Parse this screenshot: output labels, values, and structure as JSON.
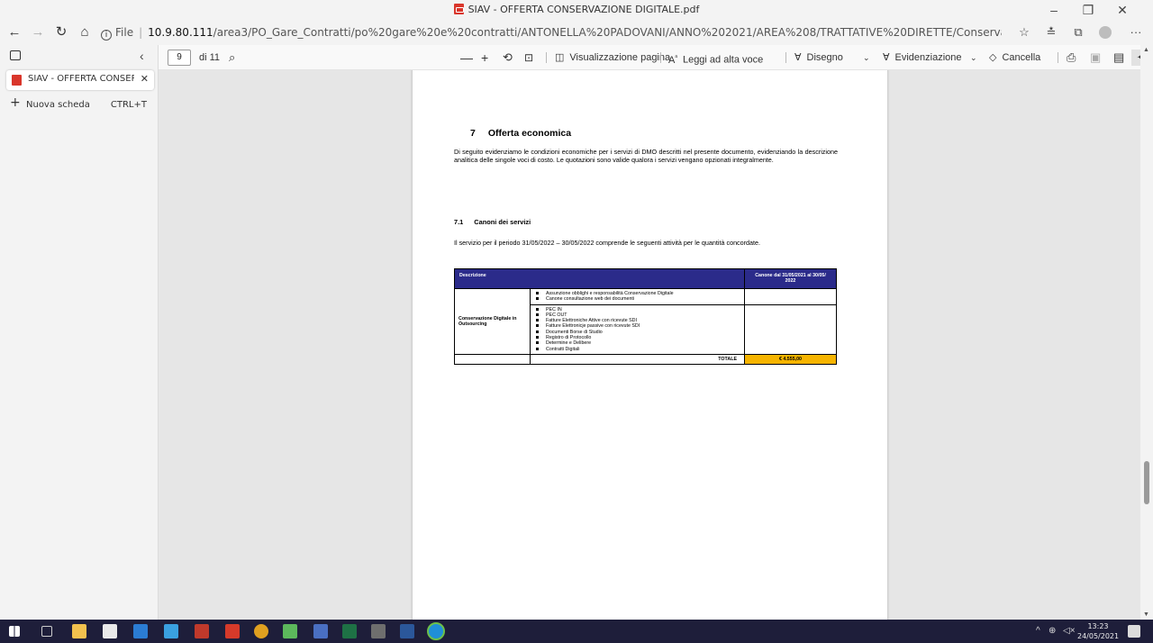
{
  "window": {
    "title": "SIAV - OFFERTA CONSERVAZIONE DIGITALE.pdf",
    "minimize": "–",
    "maximize": "❐",
    "close": "✕"
  },
  "addressbar": {
    "protocol": "File",
    "host": "10.9.80.111",
    "path": "/area3/PO_Gare_Contratti/po%20gare%20e%20contratti/ANTONELLA%20PADOVANI/ANNO%202021/AREA%208/TRATTATIVE%20DIRETTE/Conservazione%20Digitale%20AgID/Preventivo..."
  },
  "tabs": {
    "active_title": "SIAV - OFFERTA CONSERVAZION",
    "new_tab_label": "Nuova scheda",
    "new_tab_shortcut": "CTRL+T"
  },
  "pdf_toolbar": {
    "page_current": "9",
    "page_total": "di 11",
    "page_view": "Visualizzazione pagina",
    "read_aloud": "Leggi ad alta voce",
    "draw": "Disegno",
    "highlight": "Evidenziazione",
    "erase": "Cancella"
  },
  "document": {
    "section_num": "7",
    "section_title": "Offerta economica",
    "intro": "Di seguito evidenziamo le condizioni economiche per i servizi di DMO descritti nel presente documento, evidenziando la descrizione analitica delle singole voci di costo. Le quotazioni sono valide qualora i servizi vengano opzionati integralmente.",
    "subsection_num": "7.1",
    "subsection_title": "Canoni dei servizi",
    "period_text": "Il servizio  per il periodo 31/05/2022 – 30/05/2022  comprende le seguenti attività per le quantità concordate.",
    "table": {
      "header_desc": "Descrizione",
      "header_fee": "Canone dal 31/05/2021 al 30/05/ 2022",
      "category": "Conservazione Digitale in Outsourcing",
      "group1": [
        "Assunzione obblighi e responsabilità Conservazione Digitale",
        "Canone consultazione web dei documenti"
      ],
      "group2": [
        "PEC IN",
        "PEC OUT",
        "Fatture Elettroniche Attive con ricevute SDI",
        "Fatture Elettronicje  passive con ricevute SDI",
        "Documenti Borse di Studio",
        "Registro di Protocollo",
        "Determine e Delibere",
        "Contratti Digitali"
      ],
      "total_label": "TOTALE",
      "total_value": "€ 4.555,00"
    }
  },
  "taskbar": {
    "time": "13:23",
    "date": "24/05/2021"
  },
  "colors": {
    "table_header": "#2b2b8a",
    "total_highlight": "#f6b400",
    "taskbar": "#1e1e3a"
  }
}
